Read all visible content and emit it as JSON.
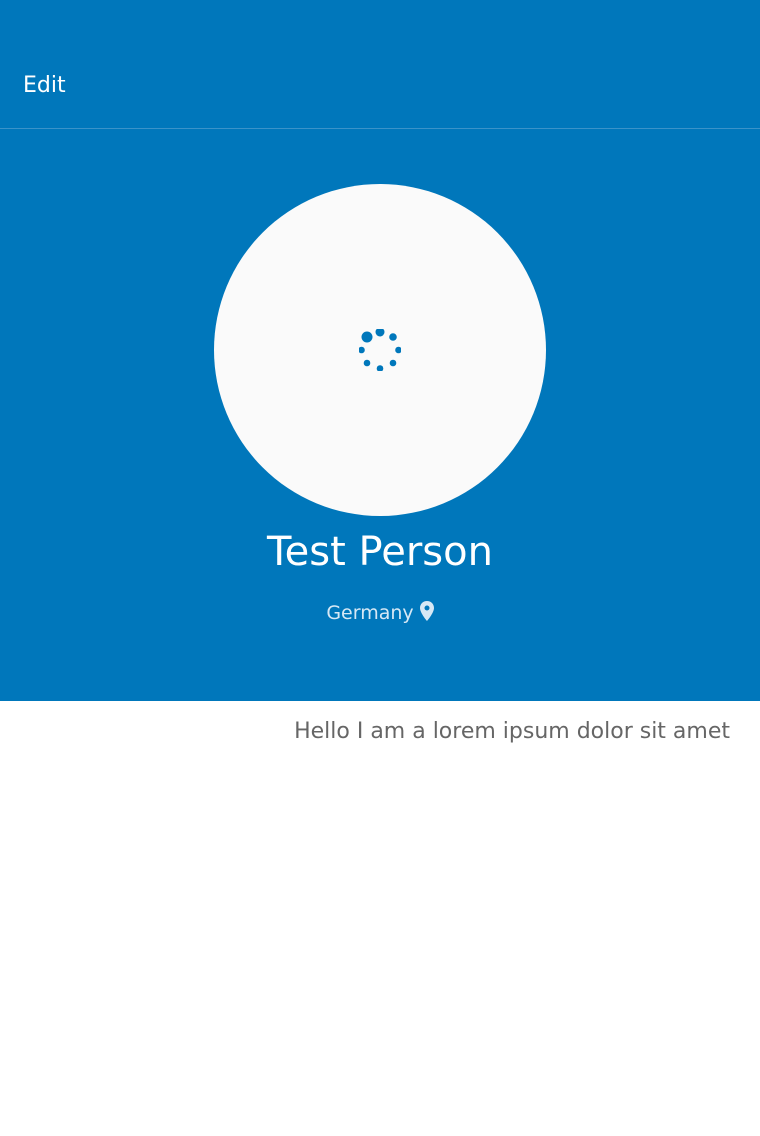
{
  "header": {
    "edit_label": "Edit"
  },
  "profile": {
    "name": "Test Person",
    "location": "Germany",
    "bio": "Hello I am a lorem ipsum dolor sit amet"
  },
  "colors": {
    "brand": "#0077BB"
  },
  "icons": {
    "spinner": "loading-spinner-icon",
    "location": "map-pin-icon"
  }
}
